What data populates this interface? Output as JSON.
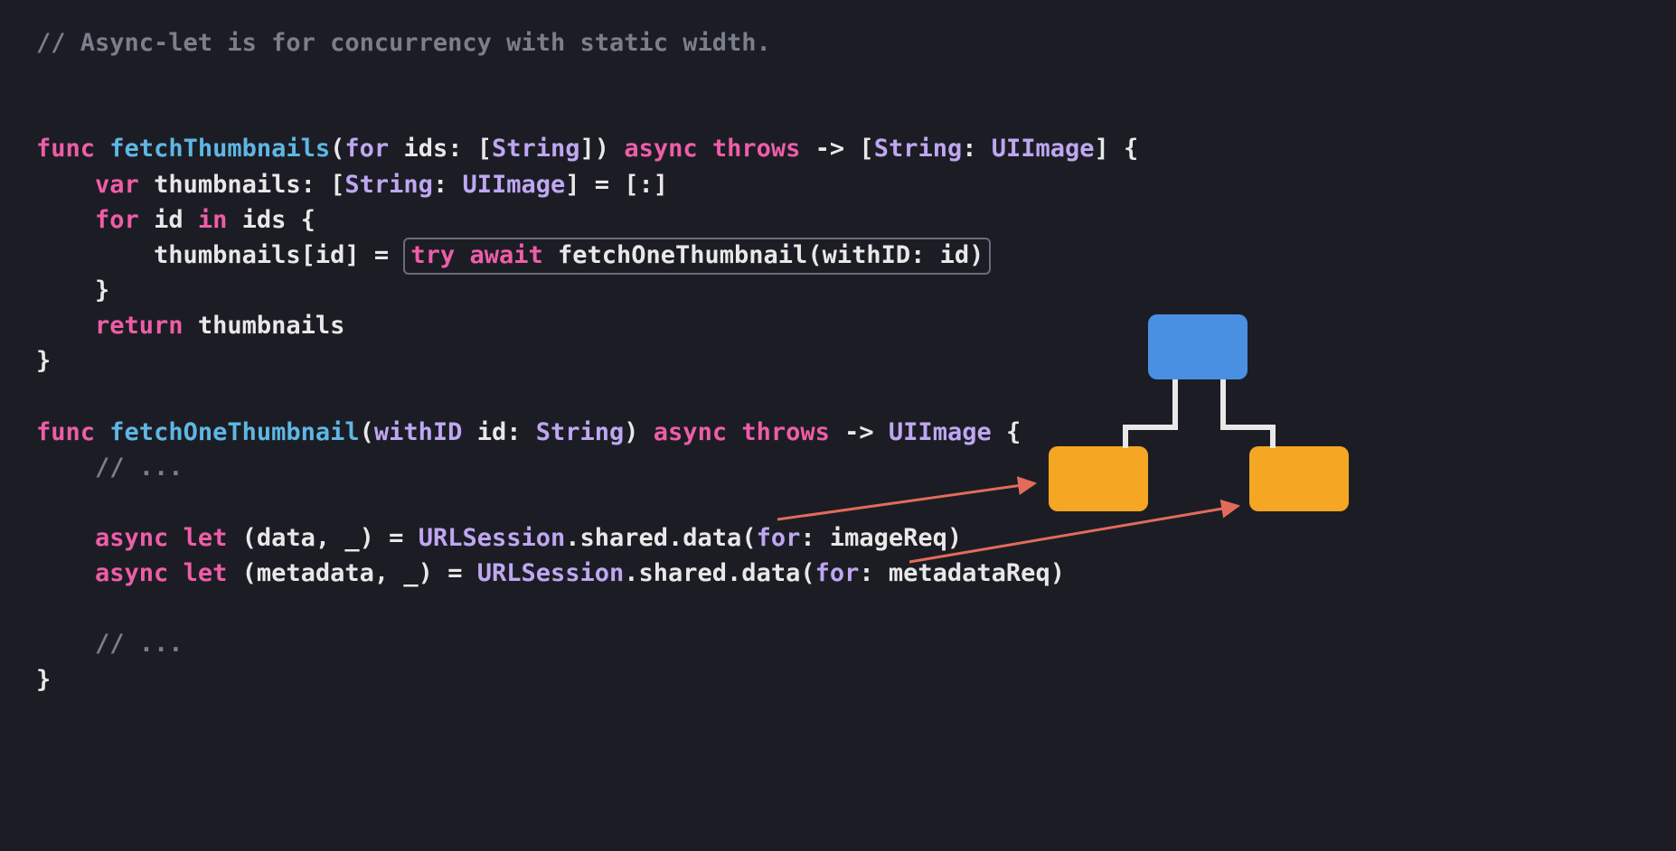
{
  "comment_top": "// Async-let is for concurrency with static width.",
  "func1": {
    "kw_func": "func",
    "name": "fetchThumbnails",
    "open": "(",
    "label_for": "for",
    "param": " ids: [",
    "type_string": "String",
    "close_param": "]) ",
    "kw_async": "async",
    "sp1": " ",
    "kw_throws": "throws",
    "arrow": " -> [",
    "ret_string": "String",
    "ret_sep": ": ",
    "ret_uiimage": "UIImage",
    "ret_close": "] {"
  },
  "line_var": {
    "indent": "    ",
    "kw_var": "var",
    "rest1": " thumbnails: [",
    "t_string": "String",
    "sep": ": ",
    "t_uiimage": "UIImage",
    "rest2": "] = [:]"
  },
  "line_for": {
    "indent": "    ",
    "kw_for": "for",
    "mid": " id ",
    "kw_in": "in",
    "rest": " ids {"
  },
  "line_assign": {
    "indent": "        ",
    "lhs": "thumbnails[id] = ",
    "kw_try": "try",
    "sp": " ",
    "kw_await": "await",
    "call": " fetchOneThumbnail(withID: id)"
  },
  "line_close1": "    }",
  "line_return": {
    "indent": "    ",
    "kw_return": "return",
    "rest": " thumbnails"
  },
  "line_close2": "}",
  "blank": "",
  "func2": {
    "kw_func": "func",
    "name": "fetchOneThumbnail",
    "open": "(",
    "label_withID": "withID",
    "param": " id: ",
    "type_string": "String",
    "close": ") ",
    "kw_async": "async",
    "sp1": " ",
    "kw_throws": "throws",
    "arrow": " -> ",
    "ret_uiimage": "UIImage",
    "brace": " {"
  },
  "ellipsis1": "    // ...",
  "al1": {
    "indent": "    ",
    "kw_async": "async",
    "sp1": " ",
    "kw_let": "let",
    "tuple": " (data, _) = ",
    "lib": "URLSession",
    "rest1": ".shared.data(",
    "label_for": "for",
    "rest2": ": imageReq)"
  },
  "al2": {
    "indent": "    ",
    "kw_async": "async",
    "sp1": " ",
    "kw_let": "let",
    "tuple": " (metadata, _) = ",
    "lib": "URLSession",
    "rest1": ".shared.data(",
    "label_for": "for",
    "rest2": ": metadataReq)"
  },
  "ellipsis2": "    // ...",
  "line_close3": "}",
  "diagram": {
    "parent_color": "#4a90e2",
    "child_color": "#f5a623",
    "arrow_color": "#e26b5a"
  }
}
